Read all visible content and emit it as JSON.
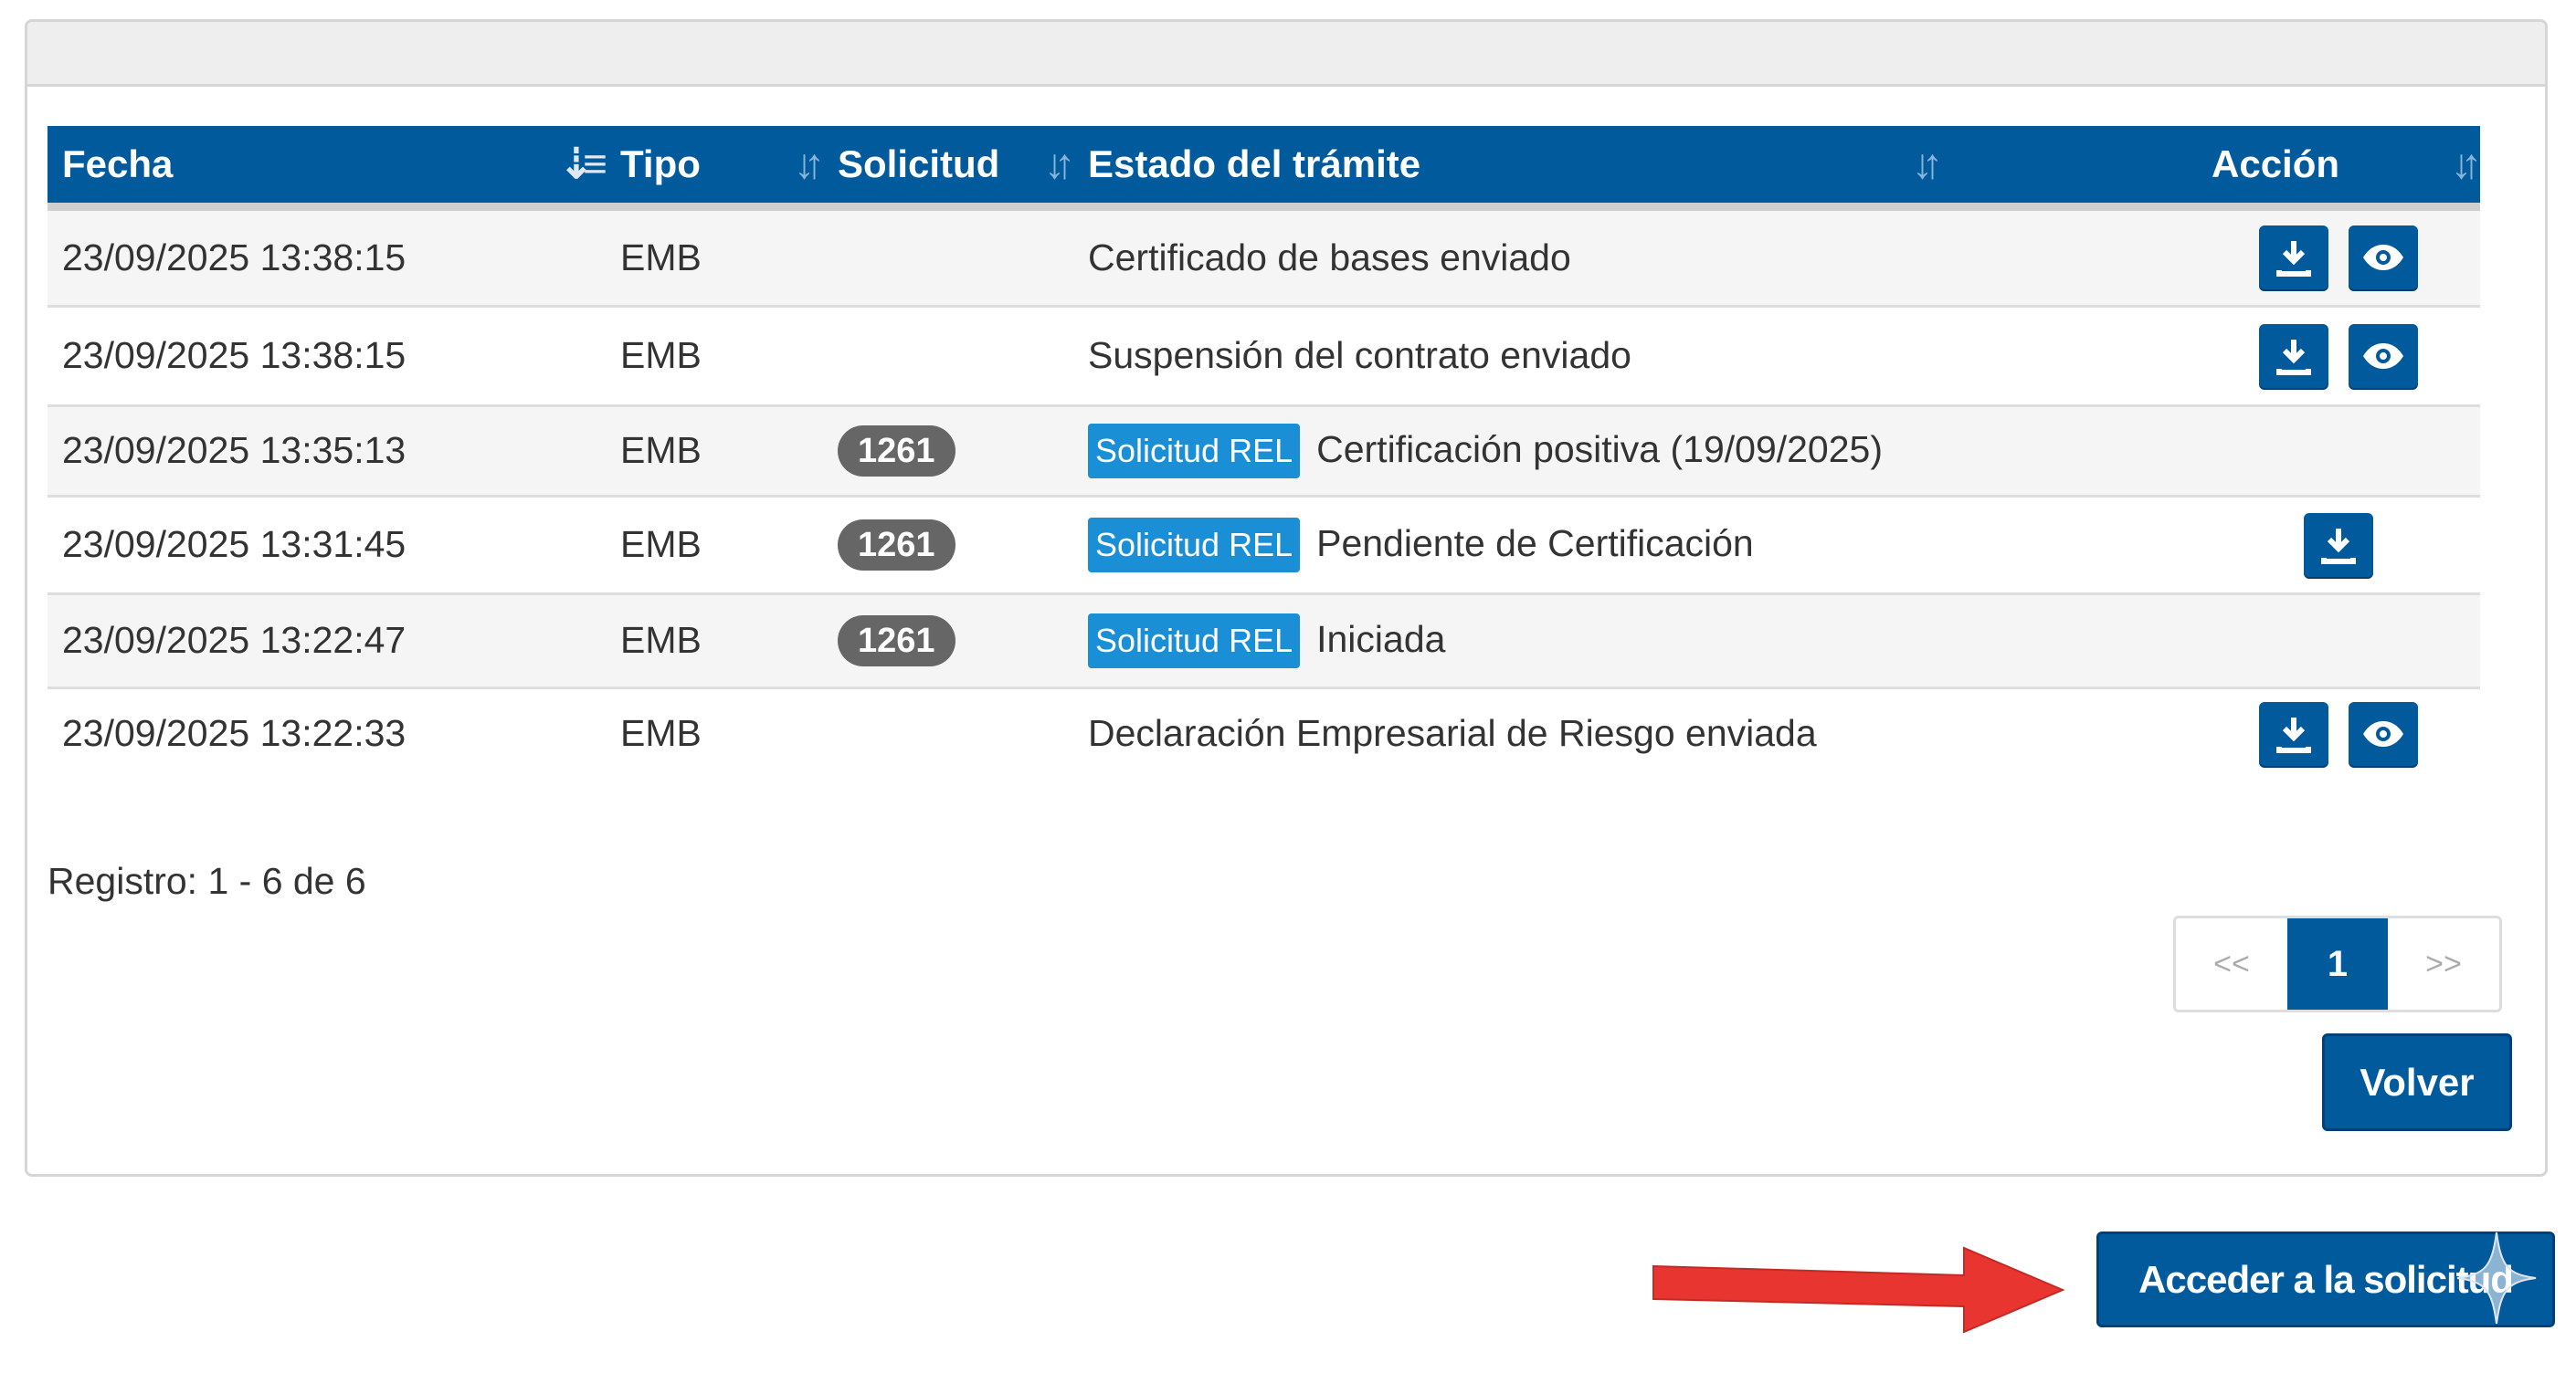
{
  "table": {
    "headers": [
      {
        "label": "Fecha"
      },
      {
        "label": "Tipo"
      },
      {
        "label": "Solicitud"
      },
      {
        "label": "Estado del trámite"
      },
      {
        "label": "Acción"
      }
    ],
    "rows": [
      {
        "fecha": "23/09/2025 13:38:15",
        "tipo": "EMB",
        "solicitud": "",
        "rel": "",
        "estado": "Certificado de bases enviado"
      },
      {
        "fecha": "23/09/2025 13:38:15",
        "tipo": "EMB",
        "solicitud": "",
        "rel": "",
        "estado": "Suspensión del contrato enviado"
      },
      {
        "fecha": "23/09/2025 13:35:13",
        "tipo": "EMB",
        "solicitud": "1261",
        "rel": "Solicitud REL",
        "estado": "Certificación positiva (19/09/2025)"
      },
      {
        "fecha": "23/09/2025 13:31:45",
        "tipo": "EMB",
        "solicitud": "1261",
        "rel": "Solicitud REL",
        "estado": "Pendiente de Certificación"
      },
      {
        "fecha": "23/09/2025 13:22:47",
        "tipo": "EMB",
        "solicitud": "1261",
        "rel": "Solicitud REL",
        "estado": "Iniciada"
      },
      {
        "fecha": "23/09/2025 13:22:33",
        "tipo": "EMB",
        "solicitud": "",
        "rel": "",
        "estado": "Declaración Empresarial de Riesgo enviada"
      }
    ]
  },
  "registro": "Registro: 1 - 6 de 6",
  "pagination": {
    "prev": "<<",
    "current": "1",
    "next": ">>"
  },
  "buttons": {
    "volver": "Volver",
    "acceder": "Acceder a la solicitud"
  },
  "colors": {
    "primary": "#005a9c",
    "rel_badge": "#1a8fd6",
    "count_badge": "#666666",
    "arrow": "#e8352f"
  },
  "icons": {
    "download": "download-icon",
    "view": "eye-icon",
    "sort": "sort-icon"
  }
}
